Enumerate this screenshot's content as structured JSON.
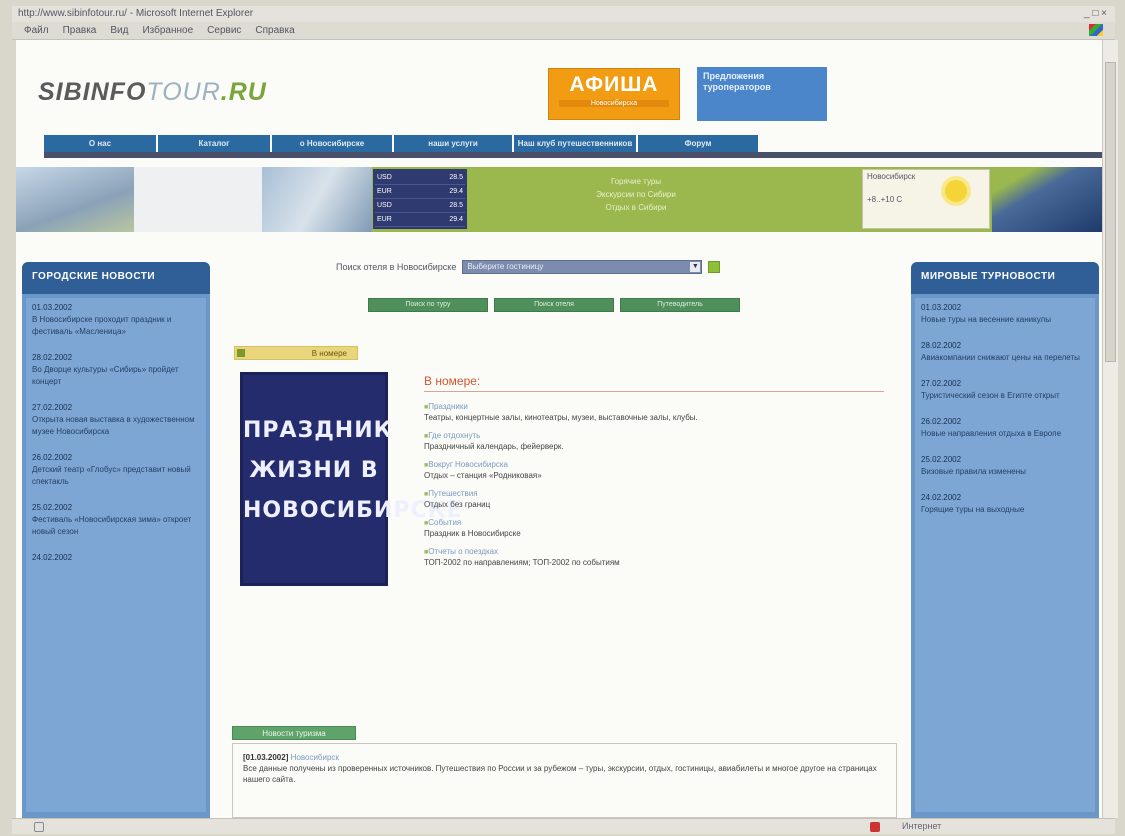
{
  "browser": {
    "title": "http://www.sibinfotour.ru/ - Microsoft Internet Explorer",
    "menu": [
      "Файл",
      "Правка",
      "Вид",
      "Избранное",
      "Сервис",
      "Справка"
    ],
    "status_right": "Интернет"
  },
  "header": {
    "logo_main": "SIBINFO",
    "logo_tour": "TOUR",
    "logo_ru": ".RU",
    "afisha_title": "АФИША",
    "afisha_sub": "Новосибирска",
    "promo_text": "Предложения туроператоров"
  },
  "nav": {
    "tabs": [
      "О нас",
      "Каталог",
      "о Новосибирске",
      "наши услуги",
      "Наш клуб путешественников",
      "Форум"
    ]
  },
  "strip": {
    "currency": [
      {
        "name": "USD",
        "value": "28.5"
      },
      {
        "name": "EUR",
        "value": "29.4"
      },
      {
        "name": "USD",
        "value": "28.5"
      },
      {
        "name": "EUR",
        "value": "29.4"
      }
    ],
    "center_lines": [
      "Горячие туры",
      "Экскурсии по Сибири",
      "Отдых в Сибири"
    ],
    "weather_label": "Новосибирск",
    "weather_temp": "+8..+10 C"
  },
  "search": {
    "label": "Поиск отеля в Новосибирске",
    "selected": "Выберите гостиницу"
  },
  "green_buttons": [
    "Поиск по туру",
    "Поиск отеля",
    "Путеводитель"
  ],
  "left_column": {
    "title": "ГОРОДСКИЕ НОВОСТИ",
    "news": [
      {
        "date": "01.03.2002",
        "text": "В Новосибирске проходит праздник и фестиваль «Масленица»"
      },
      {
        "date": "28.02.2002",
        "text": "Во Дворце культуры «Сибирь» пройдет концерт"
      },
      {
        "date": "27.02.2002",
        "text": "Открыта новая выставка в художественном музее Новосибирска"
      },
      {
        "date": "26.02.2002",
        "text": "Детский театр «Глобус» представит новый спектакль"
      },
      {
        "date": "25.02.2002",
        "text": "Фестиваль «Новосибирская зима» откроет новый сезон"
      },
      {
        "date": "24.02.2002",
        "text": ""
      }
    ]
  },
  "right_column": {
    "title": "МИРОВЫЕ ТУРНОВОСТИ",
    "news": [
      {
        "date": "01.03.2002",
        "text": "Новые туры на весенние каникулы"
      },
      {
        "date": "28.02.2002",
        "text": "Авиакомпании снижают цены на перелеты"
      },
      {
        "date": "27.02.2002",
        "text": "Туристический сезон в Египте открыт"
      },
      {
        "date": "26.02.2002",
        "text": "Новые направления отдыха в Европе"
      },
      {
        "date": "25.02.2002",
        "text": "Визовые правила изменены"
      },
      {
        "date": "24.02.2002",
        "text": "Горящие туры на выходные"
      }
    ]
  },
  "issue": {
    "label": "В номере",
    "cover_text": "ПРАЗДНИК ЖИЗНИ В НОВОСИБИРСКЕ",
    "title": "В номере:",
    "items": [
      {
        "link": "Праздники",
        "desc": "Театры, концертные залы, кинотеатры, музеи, выставочные залы, клубы."
      },
      {
        "link": "Где отдохнуть",
        "desc": "Праздничный календарь, фейерверк."
      },
      {
        "link": "Вокруг Новосибирска",
        "desc": "Отдых – станция «Родниковая»"
      },
      {
        "link": "Путешествия",
        "desc": "Отдых без границ"
      },
      {
        "link": "События",
        "desc": "Праздник в Новосибирске"
      },
      {
        "link": "Отчеты о поездках",
        "desc": "ТОП-2002 по направлениям; ТОП-2002 по событиям"
      }
    ]
  },
  "bottom": {
    "label": "Новости туризма",
    "date": "[01.03.2002]",
    "link": "Новосибирск",
    "text": "Все данные получены из проверенных источников. Путешествия по России и за рубежом – туры, экскурсии, отдых, гостиницы, авиабилеты и многое другое на страницах нашего сайта."
  }
}
